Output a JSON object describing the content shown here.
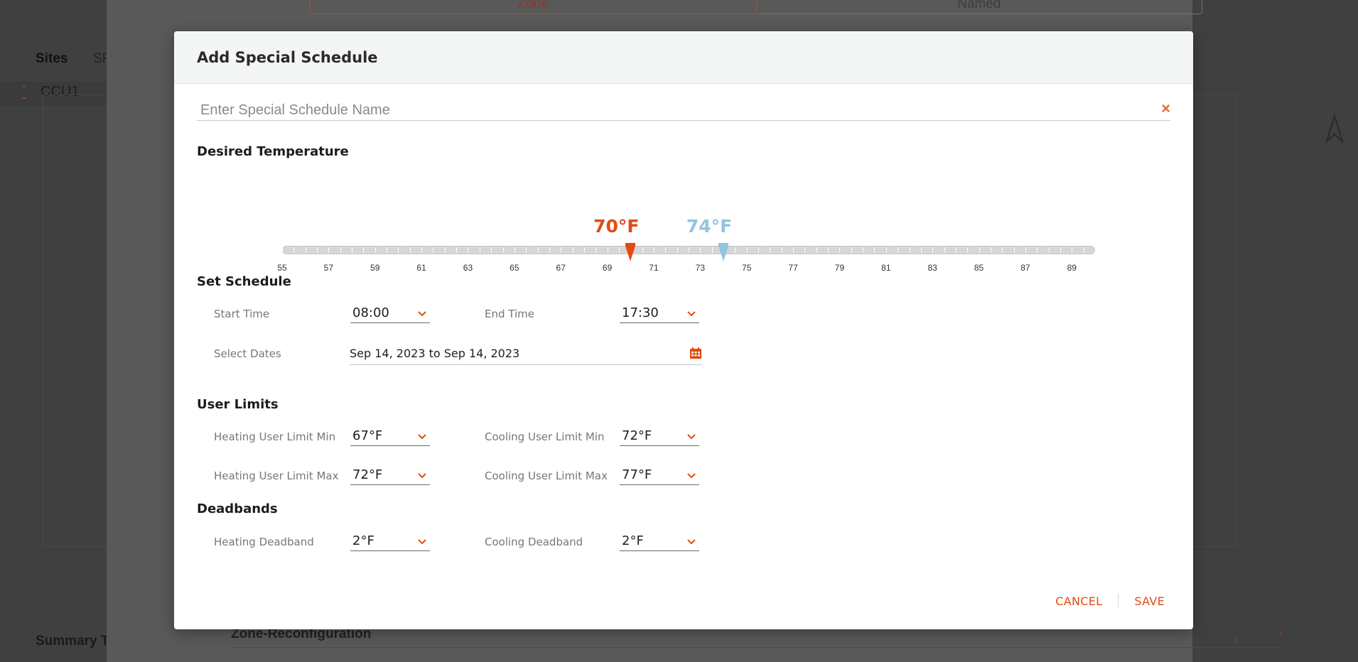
{
  "background": {
    "nav_sites": "Sites",
    "nav_sp": "SP",
    "ccu": "CCU1",
    "summary": "Summary T",
    "tabs": [
      "Zone",
      "Named"
    ],
    "zone_row": "Zone-Reconfiguration"
  },
  "modal": {
    "title": "Add Special Schedule",
    "name_placeholder": "Enter Special Schedule Name",
    "close_glyph": "×",
    "desired_temperature": {
      "title": "Desired Temperature",
      "min": 55,
      "max": 90,
      "tick_labels": [
        "55",
        "57",
        "59",
        "61",
        "63",
        "65",
        "67",
        "69",
        "71",
        "73",
        "75",
        "77",
        "79",
        "81",
        "83",
        "85",
        "87",
        "89"
      ],
      "heating_value": 70,
      "cooling_value": 74,
      "heating_label": "70°F",
      "cooling_label": "74°F",
      "heating_color": "#e24a12",
      "cooling_color": "#93c4e0"
    },
    "set_schedule": {
      "title": "Set Schedule",
      "start_label": "Start Time",
      "start_value": "08:00",
      "end_label": "End Time",
      "end_value": "17:30",
      "dates_label": "Select Dates",
      "dates_value": "Sep 14, 2023 to Sep 14, 2023"
    },
    "user_limits": {
      "title": "User Limits",
      "heat_min_label": "Heating User Limit Min",
      "heat_min_value": "67°F",
      "cool_min_label": "Cooling User Limit Min",
      "cool_min_value": "72°F",
      "heat_max_label": "Heating User Limit Max",
      "heat_max_value": "72°F",
      "cool_max_label": "Cooling User Limit Max",
      "cool_max_value": "77°F"
    },
    "deadbands": {
      "title": "Deadbands",
      "heat_label": "Heating Deadband",
      "heat_value": "2°F",
      "cool_label": "Cooling Deadband",
      "cool_value": "2°F"
    },
    "footer": {
      "cancel": "CANCEL",
      "save": "SAVE"
    },
    "accent_color": "#e24a12",
    "icons": {
      "close": "close-icon",
      "caret": "chevron-down-icon",
      "calendar": "calendar-icon"
    }
  }
}
